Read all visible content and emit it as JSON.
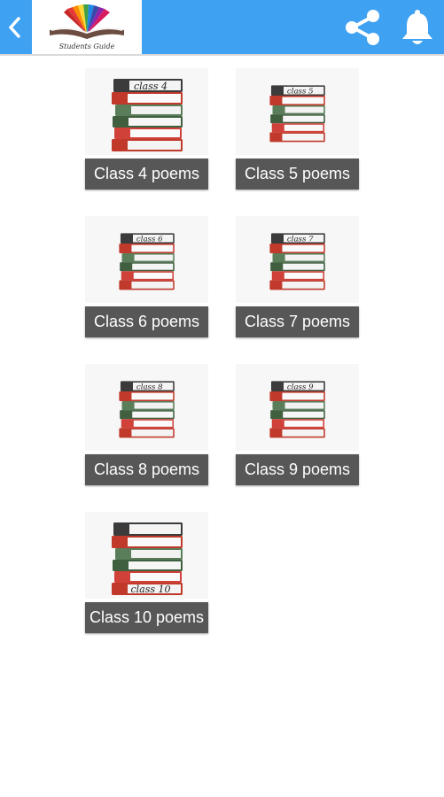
{
  "header": {
    "logo_caption": "Students Guide",
    "icons": {
      "back": "chevron-left-icon",
      "share": "share-icon",
      "notifications": "bell-icon"
    },
    "colors": {
      "bar": "#3fa1f2",
      "icon": "#ffffff"
    }
  },
  "tiles": [
    {
      "label": "Class 4 poems",
      "book_label": "class 4"
    },
    {
      "label": "Class 5 poems",
      "book_label": "class 5"
    },
    {
      "label": "Class 6 poems",
      "book_label": "class 6"
    },
    {
      "label": "Class 7 poems",
      "book_label": "class 7"
    },
    {
      "label": "Class 8 poems",
      "book_label": "class 8"
    },
    {
      "label": "Class 9 poems",
      "book_label": "class 9"
    },
    {
      "label": "Class 10 poems",
      "book_label": "class 10"
    }
  ],
  "colors": {
    "label_bg": "#575757",
    "label_text": "#ffffff"
  }
}
